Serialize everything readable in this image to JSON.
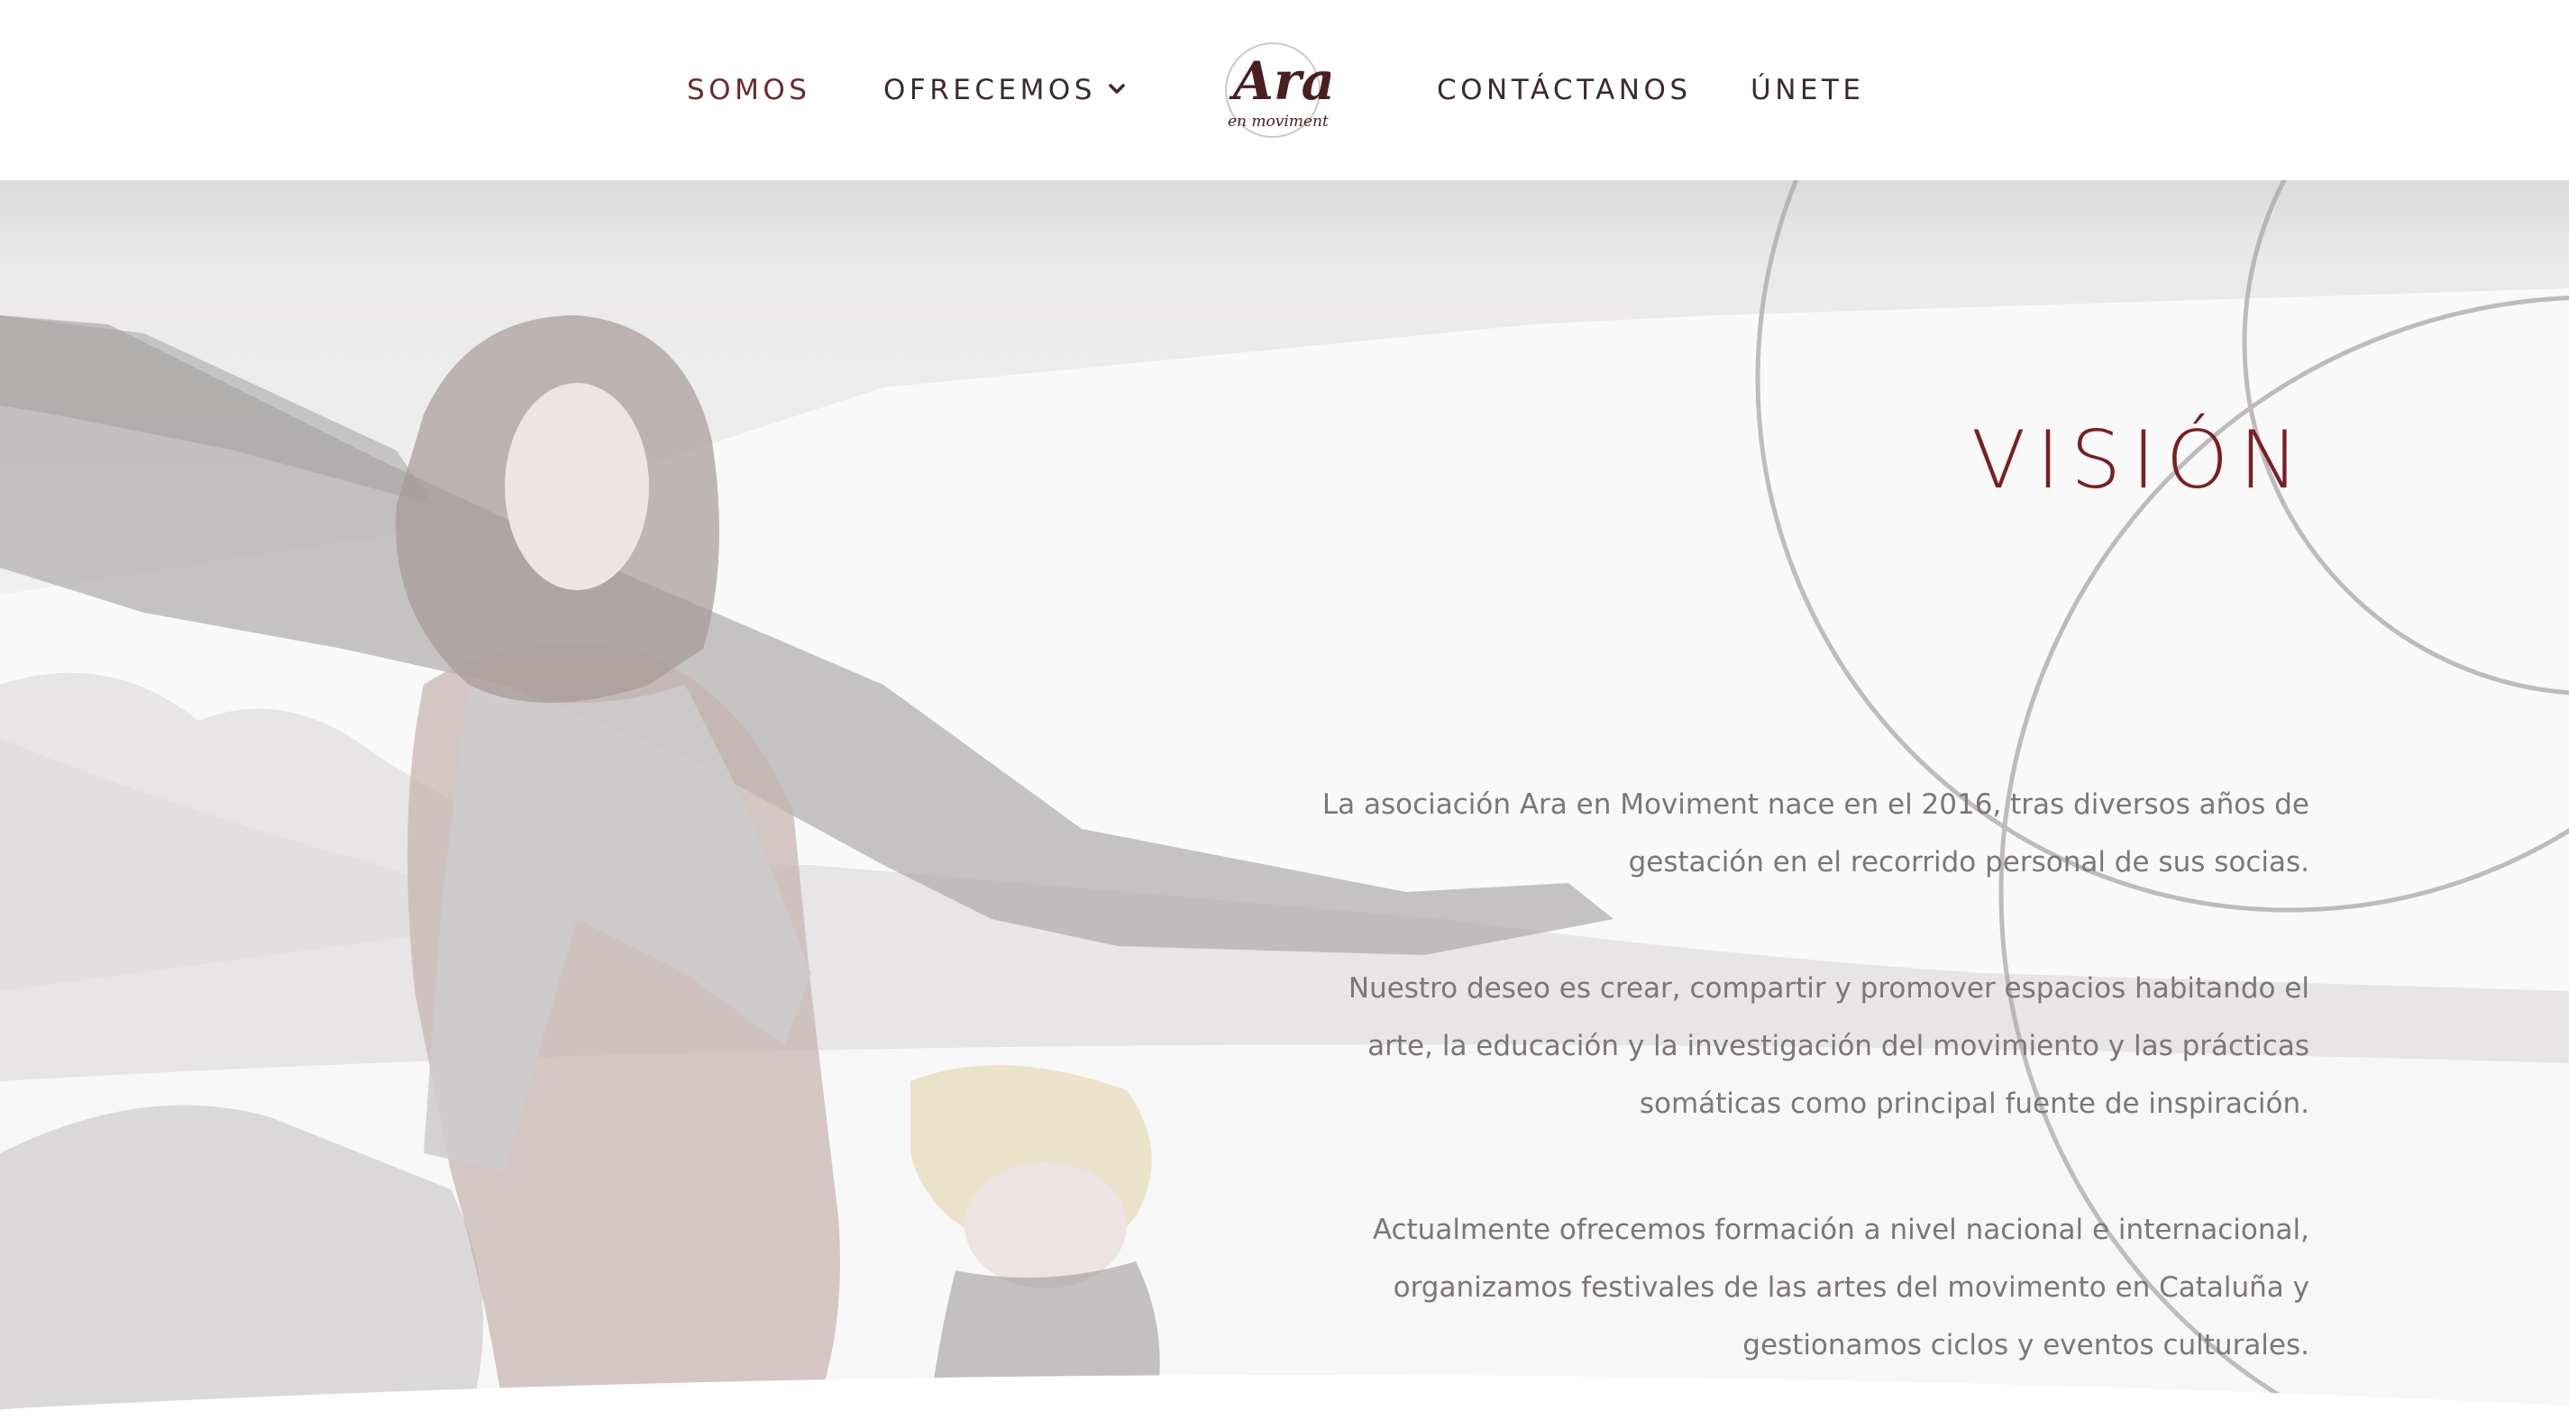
{
  "nav": {
    "somos": "SOMOS",
    "ofrecemos": "OFRECEMOS",
    "contactanos": "CONTÁCTANOS",
    "unete": "ÚNETE"
  },
  "logo": {
    "line1": "Ara",
    "line2": "en moviment"
  },
  "hero": {
    "title": "VISIÓN",
    "paragraphs": [
      [
        "La asociación Ara en Moviment nace en el 2016, tras diversos años de",
        "gestación en el recorrido personal de sus socias."
      ],
      [
        "Nuestro deseo es crear, compartir y promover espacios habitando el",
        "arte, la educación y la investigación del movimiento y las prácticas",
        "somáticas como principal fuente de inspiración."
      ],
      [
        "Actualmente ofrecemos formación a nivel nacional e internacional,",
        "organizamos festivales de las artes del movimento en Cataluña y",
        "gestionamos ciclos y eventos culturales."
      ]
    ]
  },
  "colors": {
    "accent": "#7a1f22",
    "nav_text": "#3c2a2e",
    "body_text": "#7b7678"
  },
  "icons": {
    "dropdown": "chevron-down-icon",
    "decor": "circle-outlines"
  }
}
